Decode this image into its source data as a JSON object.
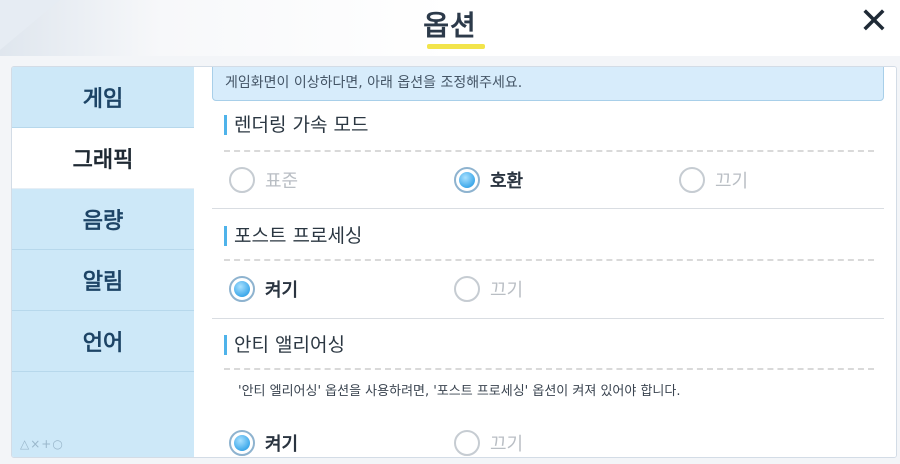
{
  "header": {
    "title": "옵션",
    "close_icon": "close-icon"
  },
  "sidebar": {
    "items": [
      {
        "label": "게임",
        "active": false
      },
      {
        "label": "그래픽",
        "active": true
      },
      {
        "label": "음량",
        "active": false
      },
      {
        "label": "알림",
        "active": false
      },
      {
        "label": "언어",
        "active": false
      }
    ],
    "footer": "△×+○"
  },
  "content": {
    "notice": "게임화면이 이상하다면, 아래 옵션을 조정해주세요.",
    "sections": [
      {
        "title": "렌더링 가속 모드",
        "options": [
          {
            "label": "표준",
            "selected": false
          },
          {
            "label": "호환",
            "selected": true
          },
          {
            "label": "끄기",
            "selected": false
          }
        ]
      },
      {
        "title": "포스트 프로세싱",
        "options": [
          {
            "label": "켜기",
            "selected": true
          },
          {
            "label": "끄기",
            "selected": false
          }
        ]
      },
      {
        "title": "안티 앨리어싱",
        "note": "'안티 엘리어싱' 옵션을 사용하려면, '포스트 프로세싱' 옵션이 켜져 있어야 합니다.",
        "options": [
          {
            "label": "켜기",
            "selected": true
          },
          {
            "label": "끄기",
            "selected": false
          }
        ]
      }
    ]
  },
  "colors": {
    "accent": "#4fb3ea",
    "sidebar_bg": "#cde8f8",
    "title_underline": "#f2e44b"
  }
}
